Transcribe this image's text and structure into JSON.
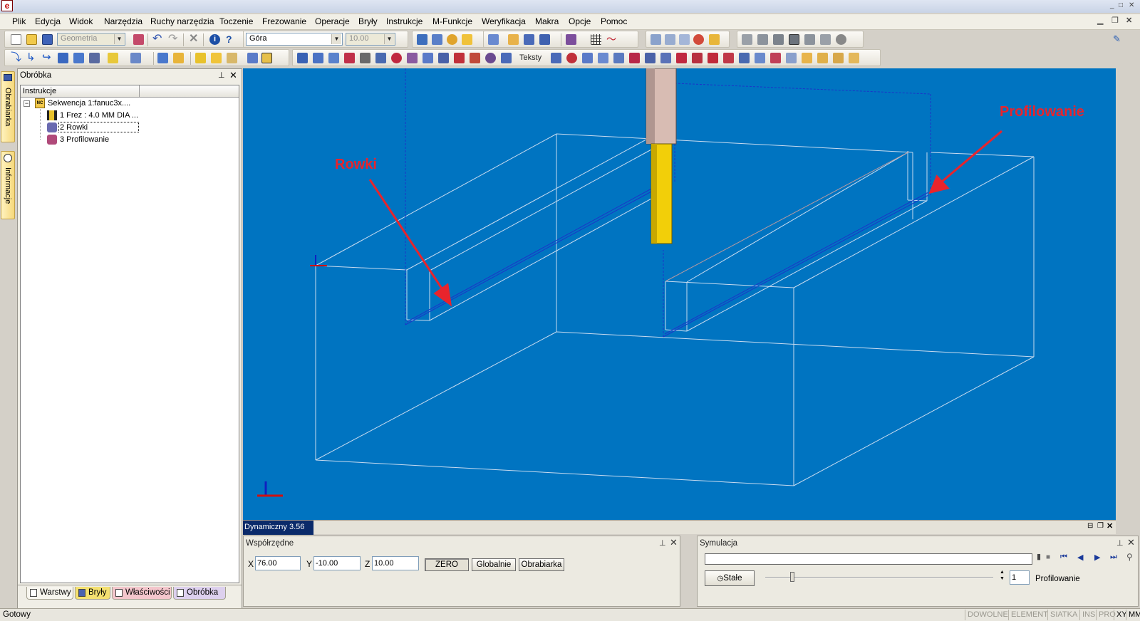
{
  "app": {
    "icon_letter": "e"
  },
  "menu": [
    "Plik",
    "Edycja",
    "Widok",
    "Narzędzia",
    "Ruchy narzędzia",
    "Toczenie",
    "Frezowanie",
    "Operacje",
    "Bryły",
    "Instrukcje",
    "M-Funkcje",
    "Weryfikacja",
    "Makra",
    "Opcje",
    "Pomoc"
  ],
  "toolbar": {
    "geometry_select": "Geometria",
    "view_select": "Góra",
    "size_select": "10.00",
    "texts_label": "Teksty"
  },
  "side_tabs": {
    "machine": "Obrabiarka",
    "info": "Informacje"
  },
  "left_panel": {
    "title": "Obróbka",
    "column_header": "Instrukcje",
    "tree": {
      "sequence": "Sekwencja 1:fanuc3x....",
      "items": [
        "1 Frez : 4.0 MM DIA ...",
        "2 Rowki",
        "3 Profilowanie"
      ]
    },
    "tabs": [
      "Warstwy",
      "Bryły",
      "Właściwości",
      "Obróbka"
    ]
  },
  "viewport": {
    "annotations": {
      "left": "Rowki",
      "right": "Profilowanie"
    },
    "status_label": "Dynamiczny 3.56",
    "colors": {
      "background": "#0074c1",
      "annotation": "#e8242c",
      "tool_shaft": "#f2cf09",
      "tool_holder": "#d8bcb3"
    }
  },
  "coords": {
    "title": "Współrzędne",
    "x_label": "X",
    "x_value": "76.00",
    "y_label": "Y",
    "y_value": "-10.00",
    "z_label": "Z",
    "z_value": "10.00",
    "buttons": [
      "ZERO",
      "Globalnie",
      "Obrabiarka"
    ]
  },
  "simulation": {
    "title": "Symulacja",
    "mode_button": "Stałe",
    "step_value": "1",
    "current_op": "Profilowanie"
  },
  "statusbar": {
    "left_text": "Gotowy",
    "cells": [
      "DOWOLNE",
      "ELEMENT",
      "SIATKA",
      "INS",
      "PRO",
      "XY",
      "MM"
    ]
  }
}
